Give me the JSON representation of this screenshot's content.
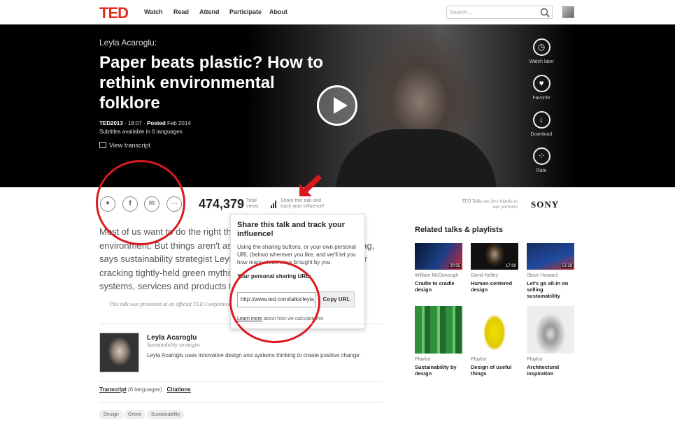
{
  "nav": {
    "logo": "TED",
    "items": [
      "Watch",
      "Read",
      "Attend",
      "Participate",
      "About"
    ],
    "search_placeholder": "Search..."
  },
  "hero": {
    "speaker": "Leyla Acaroglu:",
    "title": "Paper beats plastic? How to rethink environmental folklore",
    "event": "TED2013",
    "duration": "· 18:07 ·",
    "posted_label": "Posted",
    "posted_date": "Feb 2014",
    "subtitles": "Subtitles available in 6 languages",
    "view_transcript": "View transcript",
    "actions": [
      {
        "label": "Watch later",
        "icon": "clock-icon"
      },
      {
        "label": "Favorite",
        "icon": "heart-icon"
      },
      {
        "label": "Download",
        "icon": "download-icon"
      },
      {
        "label": "Rate",
        "icon": "dots-icon"
      }
    ]
  },
  "stats": {
    "views": "474,379",
    "views_label": "Total views",
    "share_label": "Share this talk and track your influence!"
  },
  "sponsor": {
    "text": "TED Talks are free thanks to our partners",
    "brand": "SONY"
  },
  "description": "Most of us want to do the right thing when it comes to the environment. But things aren't as simple as opting for the paper bag, says sustainability strategist Leyla Acaroglu. She makes a case for cracking tightly-held green myths and thinking bigger to create systems, services and products that ease strain on the planet.",
  "note": "This talk was presented at an official TED Conference, and was featured by our editors on the home page.",
  "popover": {
    "title": "Share this talk and track your influence!",
    "body": "Using the sharing buttons, or your own personal URL (below) wherever you like, and we'll let you how many views were brought by you.",
    "url_label": "Your personal sharing URL:",
    "url": "http://www.ted.com/talks/leyla_acaroglu",
    "copy": "Copy URL",
    "learn_more": "Learn more",
    "learn_rest": "about how we calculate this"
  },
  "speaker": {
    "name": "Leyla Acaroglu",
    "role": "Sustainability strategist",
    "bio": "Leyla Acaroglu uses innovative design and systems thinking to create positive change."
  },
  "transcript": {
    "link": "Transcript",
    "languages": "(6 languages)",
    "citations": "Citations"
  },
  "tags": [
    "Design",
    "Green",
    "Sustainability"
  ],
  "related": {
    "heading": "Related talks & playlists",
    "items": [
      {
        "meta": "William McDonough",
        "title": "Cradle to cradle design",
        "duration": "20:05"
      },
      {
        "meta": "David Kelley",
        "title": "Human-centered design",
        "duration": "17:00"
      },
      {
        "meta": "Steve Howard",
        "title": "Let's go all-in on selling sustainability",
        "duration": "13:18"
      },
      {
        "meta": "Playlist",
        "title": "Sustainability by design",
        "duration": ""
      },
      {
        "meta": "Playlist",
        "title": "Design of useful things",
        "duration": ""
      },
      {
        "meta": "Playlist",
        "title": "Architectural inspiration",
        "duration": ""
      }
    ]
  },
  "colors": {
    "ted_red": "#e62b1e",
    "annotation_red": "#d9191e"
  }
}
